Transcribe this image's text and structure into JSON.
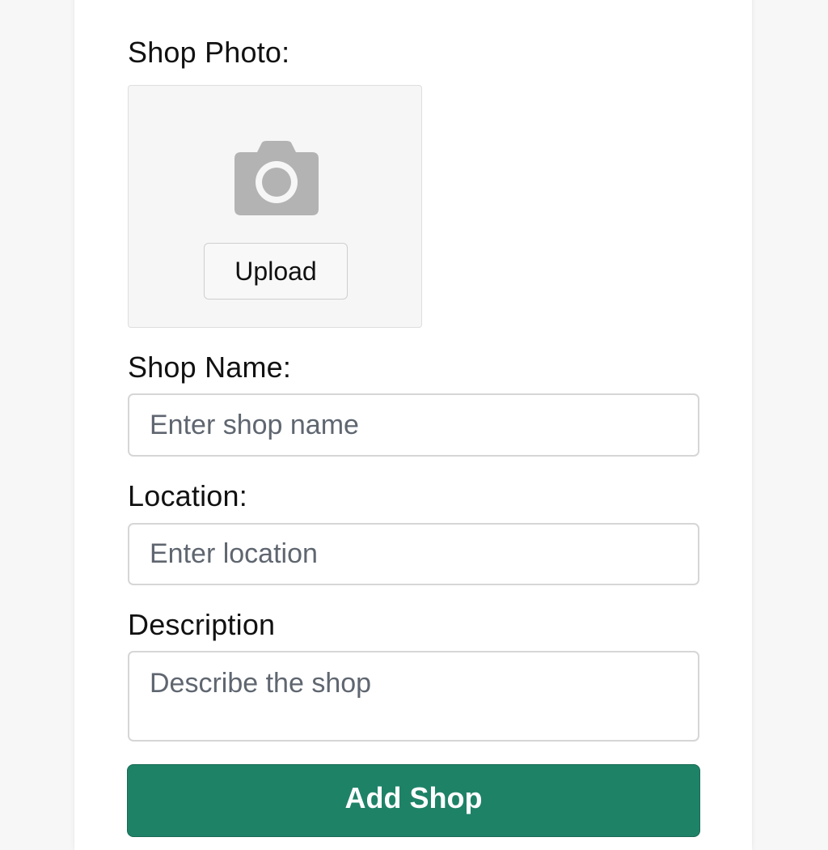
{
  "form": {
    "photo_label": "Shop Photo:",
    "upload_label": "Upload",
    "name_label": "Shop Name:",
    "name_placeholder": "Enter shop name",
    "name_value": "",
    "location_label": "Location:",
    "location_placeholder": "Enter location",
    "location_value": "",
    "description_label": "Description",
    "description_placeholder": "Describe the shop",
    "description_value": "",
    "submit_label": "Add Shop"
  },
  "icons": {
    "photo": "camera-icon"
  },
  "colors": {
    "accent": "#1e8267",
    "icon_gray": "#b3b3b3",
    "placeholder": "#5f6670",
    "border": "#d6d6d6"
  }
}
